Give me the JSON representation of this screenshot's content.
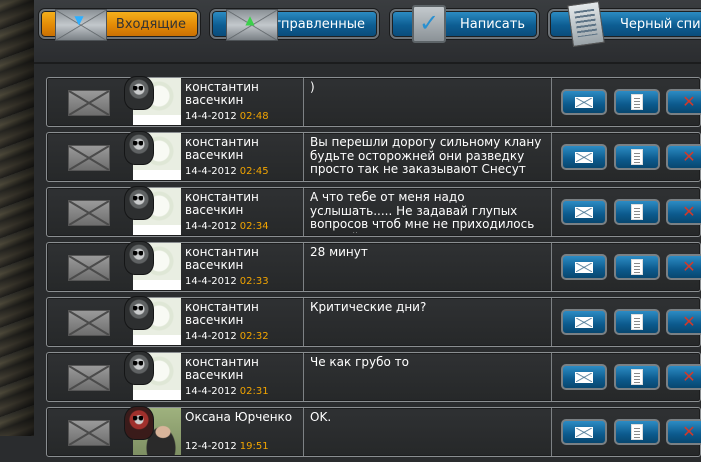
{
  "nav": {
    "inbox_label": "Входящие",
    "sent_label": "Отправленные",
    "compose_label": "Написать",
    "blacklist_label": "Черный список"
  },
  "messages": [
    {
      "sender": "константин васечкин",
      "date": "14-4-2012",
      "time": "02:48",
      "text": ")",
      "avatar": "skull-icon"
    },
    {
      "sender": "константин васечкин",
      "date": "14-4-2012",
      "time": "02:45",
      "text": "Вы перешли дорогу сильному клану будьте осторожней они разведку просто так не заказывают  Снесут луч...",
      "avatar": "skull-icon"
    },
    {
      "sender": "константин васечкин",
      "date": "14-4-2012",
      "time": "02:34",
      "text": "А что тебе от меня надо услышать..... Не задавай глупых вопросов чтоб мне не приходилось лапшой твои уши уве...",
      "avatar": "skull-icon"
    },
    {
      "sender": "константин васечкин",
      "date": "14-4-2012",
      "time": "02:33",
      "text": "28 минут",
      "avatar": "skull-icon"
    },
    {
      "sender": "константин васечкин",
      "date": "14-4-2012",
      "time": "02:32",
      "text": "Критические дни?",
      "avatar": "skull-icon"
    },
    {
      "sender": "константин васечкин",
      "date": "14-4-2012",
      "time": "02:31",
      "text": "Че как грубо то",
      "avatar": "skull-icon"
    },
    {
      "sender": "Оксана Юрченко",
      "date": "12-4-2012",
      "time": "19:51",
      "text": "OK.",
      "avatar": "photo"
    }
  ],
  "colors": {
    "accent_blue": "#0d5d92",
    "active_orange": "#e38a06",
    "time_color": "#f1a400",
    "delete_red": "#d23a2a"
  }
}
